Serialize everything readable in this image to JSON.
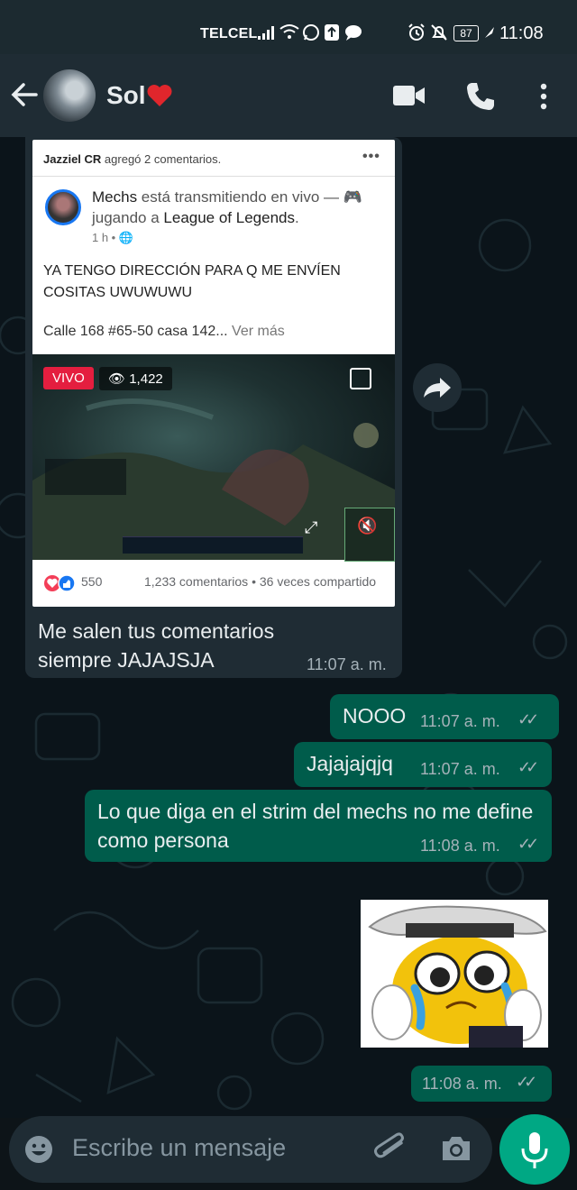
{
  "status_bar": {
    "carrier": "TELCEL",
    "battery": "87",
    "time": "11:08"
  },
  "header": {
    "contact_name": "Sol",
    "contact_emoji": "❤️"
  },
  "shared_post": {
    "added_line_name": "Jazziel CR",
    "added_line_rest": " agregó 2 comentarios.",
    "author": "Mechs",
    "activity_pre": " está transmitiendo en vivo — 🎮 jugando a ",
    "game": "League of Legends",
    "activity_post": ".",
    "time_ago": "1 h •",
    "text": "YA TENGO DIRECCIÓN PARA Q ME ENVÍEN COSITAS UWUWUWU",
    "address": "Calle 168 #65-50 casa 142...",
    "see_more": "Ver más",
    "live_label": "VIVO",
    "viewers": "1,422",
    "reactions_count": "550",
    "comments_shares": "1,233 comentarios • 36 veces compartido"
  },
  "messages": [
    {
      "direction": "in",
      "text": "Me salen tus comentarios siempre JAJAJSJA",
      "time": "11:07 a. m."
    },
    {
      "direction": "out",
      "text": "NOOO",
      "time": "11:07 a. m."
    },
    {
      "direction": "out",
      "text": "Jajajajqjq",
      "time": "11:07 a. m."
    },
    {
      "direction": "out",
      "text": "Lo que diga en el strim del mechs no me define como persona",
      "time": "11:08 a. m."
    },
    {
      "direction": "out",
      "text": "",
      "time": "11:08 a. m.",
      "sticker": true
    }
  ],
  "input": {
    "placeholder": "Escribe un mensaje"
  },
  "colors": {
    "header": "#1f2c34",
    "outgoing": "#005c4b",
    "incoming": "#1f2c34",
    "accent": "#00a884",
    "live": "#e41e3f"
  }
}
